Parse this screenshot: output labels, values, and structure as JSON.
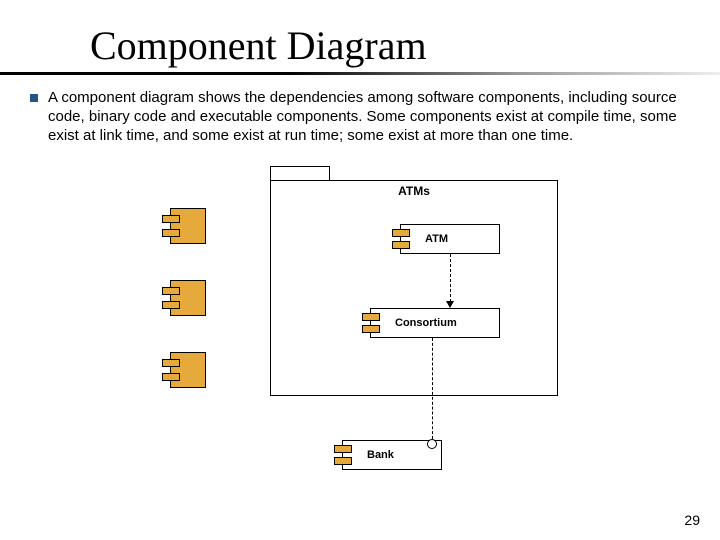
{
  "title": "Component Diagram",
  "bullet_text": "A component diagram shows the dependencies among software components, including source code, binary code and executable components. Some components exist at compile time, some exist at link time, and some exist at run time; some exist at more than one time.",
  "package_label": "ATMs",
  "components": {
    "atm": "ATM",
    "consortium": "Consortium",
    "bank": "Bank"
  },
  "page_number": "29"
}
